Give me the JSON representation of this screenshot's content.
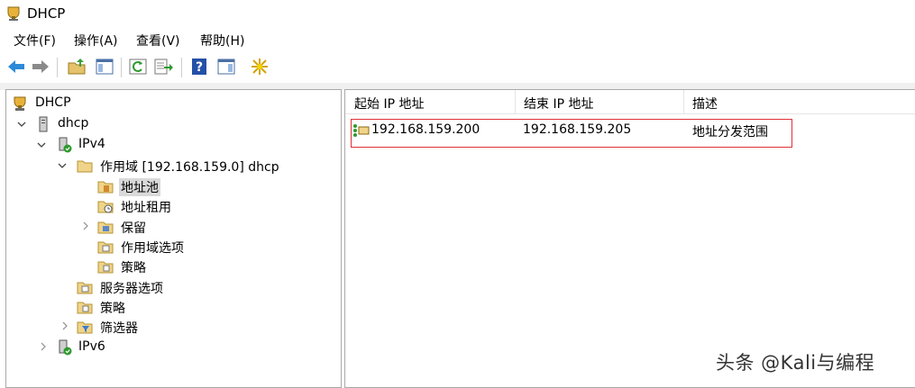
{
  "window": {
    "title": "DHCP"
  },
  "menu": [
    "文件(F)",
    "操作(A)",
    "查看(V)",
    "帮助(H)"
  ],
  "toolbar": {
    "buttons": [
      "back-icon",
      "forward-icon",
      "up-folder-icon",
      "show-hide-tree-icon",
      "refresh-icon",
      "export-list-icon",
      "help-icon",
      "show-hide-action-pane-icon",
      "new-scope-icon"
    ]
  },
  "tree": {
    "root": "DHCP",
    "server": "dhcp",
    "ipv4": "IPv4",
    "scope": "作用域 [192.168.159.0] dhcp",
    "address_pool": "地址池",
    "address_leases": "地址租用",
    "reservations": "保留",
    "scope_options": "作用域选项",
    "scope_policies": "策略",
    "server_options": "服务器选项",
    "policies": "策略",
    "filters": "筛选器",
    "ipv6": "IPv6"
  },
  "list": {
    "columns": [
      "起始 IP 地址",
      "结束 IP 地址",
      "描述"
    ],
    "rows": [
      {
        "start_ip": "192.168.159.200",
        "end_ip": "192.168.159.205",
        "description": "地址分发范围"
      }
    ]
  },
  "watermark": "头条 @Kali与编程",
  "colors": {
    "highlight_border": "#e0303a",
    "selection": "#d9d9d9"
  }
}
